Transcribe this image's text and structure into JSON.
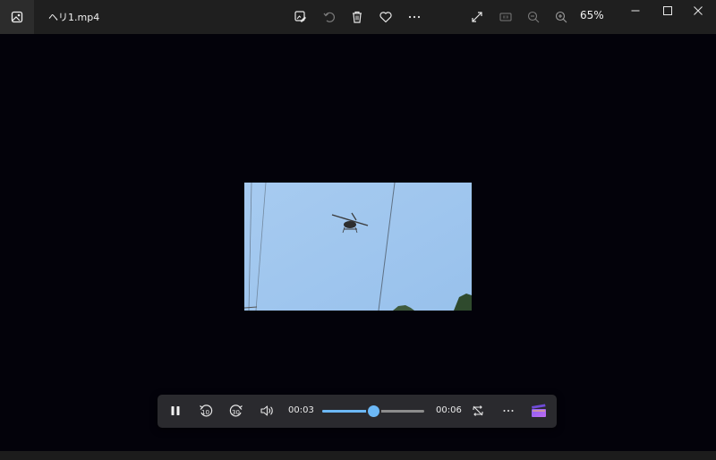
{
  "window": {
    "file_name": "ヘリ1.mp4",
    "zoom_level": "65%"
  },
  "toolbar": {
    "icons": [
      "edit-image-icon",
      "rotate-icon",
      "delete-icon",
      "favorite-heart-icon",
      "more-icon"
    ],
    "right_icons": [
      "fullscreen-icon",
      "actual-size-icon",
      "zoom-out-icon",
      "zoom-in-icon"
    ]
  },
  "window_controls": [
    "minimize-icon",
    "maximize-icon",
    "close-icon"
  ],
  "player": {
    "current_time": "00:03",
    "total_time": "00:06",
    "progress": 0.5,
    "skip_back_label": "10",
    "skip_forward_label": "30",
    "state": "playing"
  },
  "colors": {
    "accent": "#6cb8f6",
    "titlebar": "#1f1f1f",
    "background": "#03020a",
    "sky": "#9fc6ee"
  }
}
